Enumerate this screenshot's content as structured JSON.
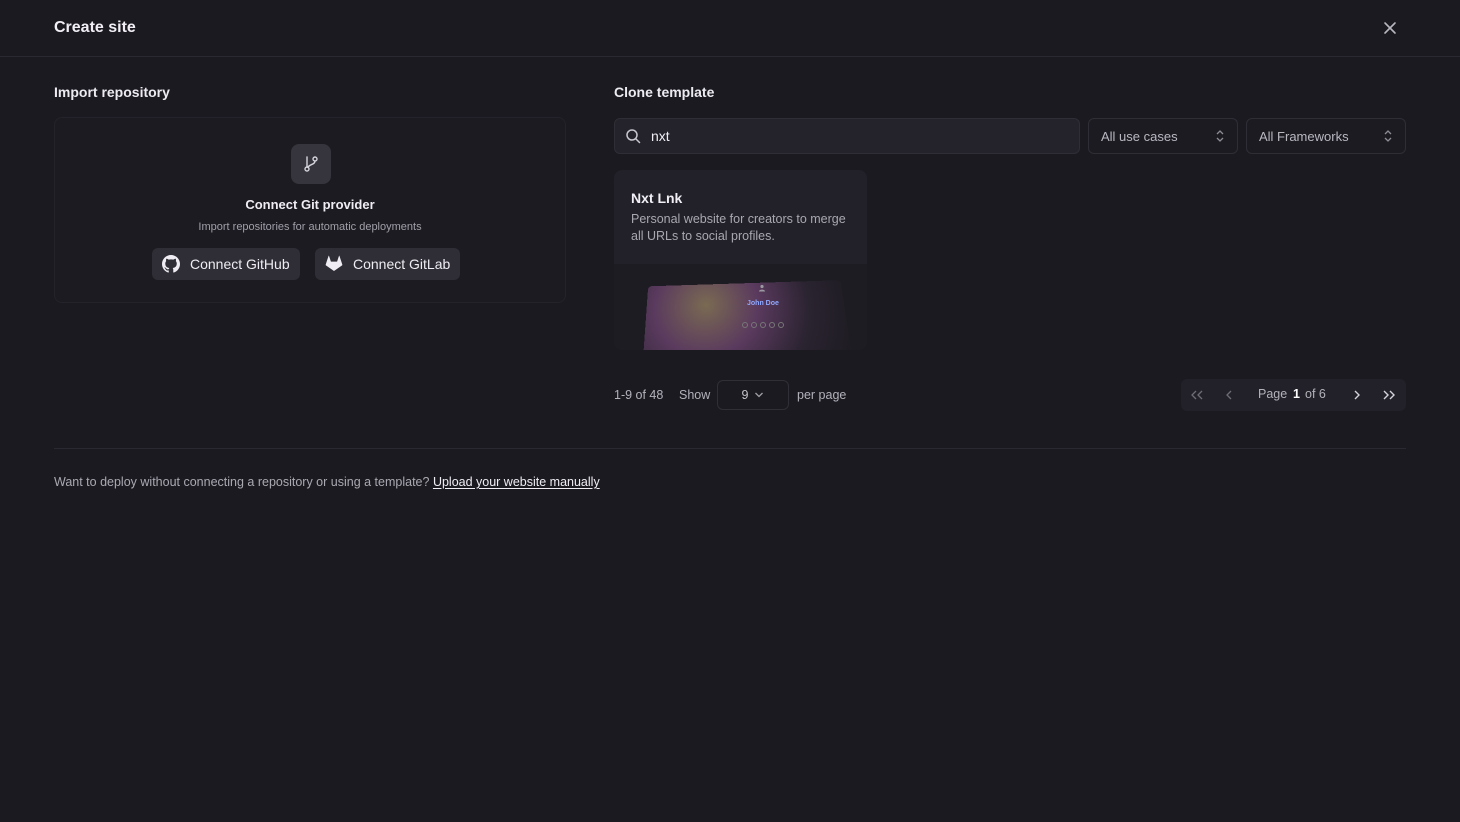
{
  "header": {
    "title": "Create site"
  },
  "import": {
    "section_title": "Import repository",
    "heading": "Connect Git provider",
    "subheading": "Import repositories for automatic deployments",
    "github_label": "Connect GitHub",
    "gitlab_label": "Connect GitLab"
  },
  "clone": {
    "section_title": "Clone template",
    "search_value": "nxt",
    "use_case_filter": "All use cases",
    "framework_filter": "All Frameworks"
  },
  "templates": [
    {
      "name": "Nxt Lnk",
      "description": "Personal website for creators to merge all URLs to social profiles.",
      "preview_name": "John Doe"
    }
  ],
  "pagination": {
    "range": "1-9 of 48",
    "show_label": "Show",
    "per_page_value": "9",
    "per_page_label": "per page",
    "page_label": "Page",
    "current_page": "1",
    "total_label": "of 6"
  },
  "footer": {
    "text": "Want to deploy without connecting a repository or using a template?",
    "link": "Upload your website manually"
  }
}
